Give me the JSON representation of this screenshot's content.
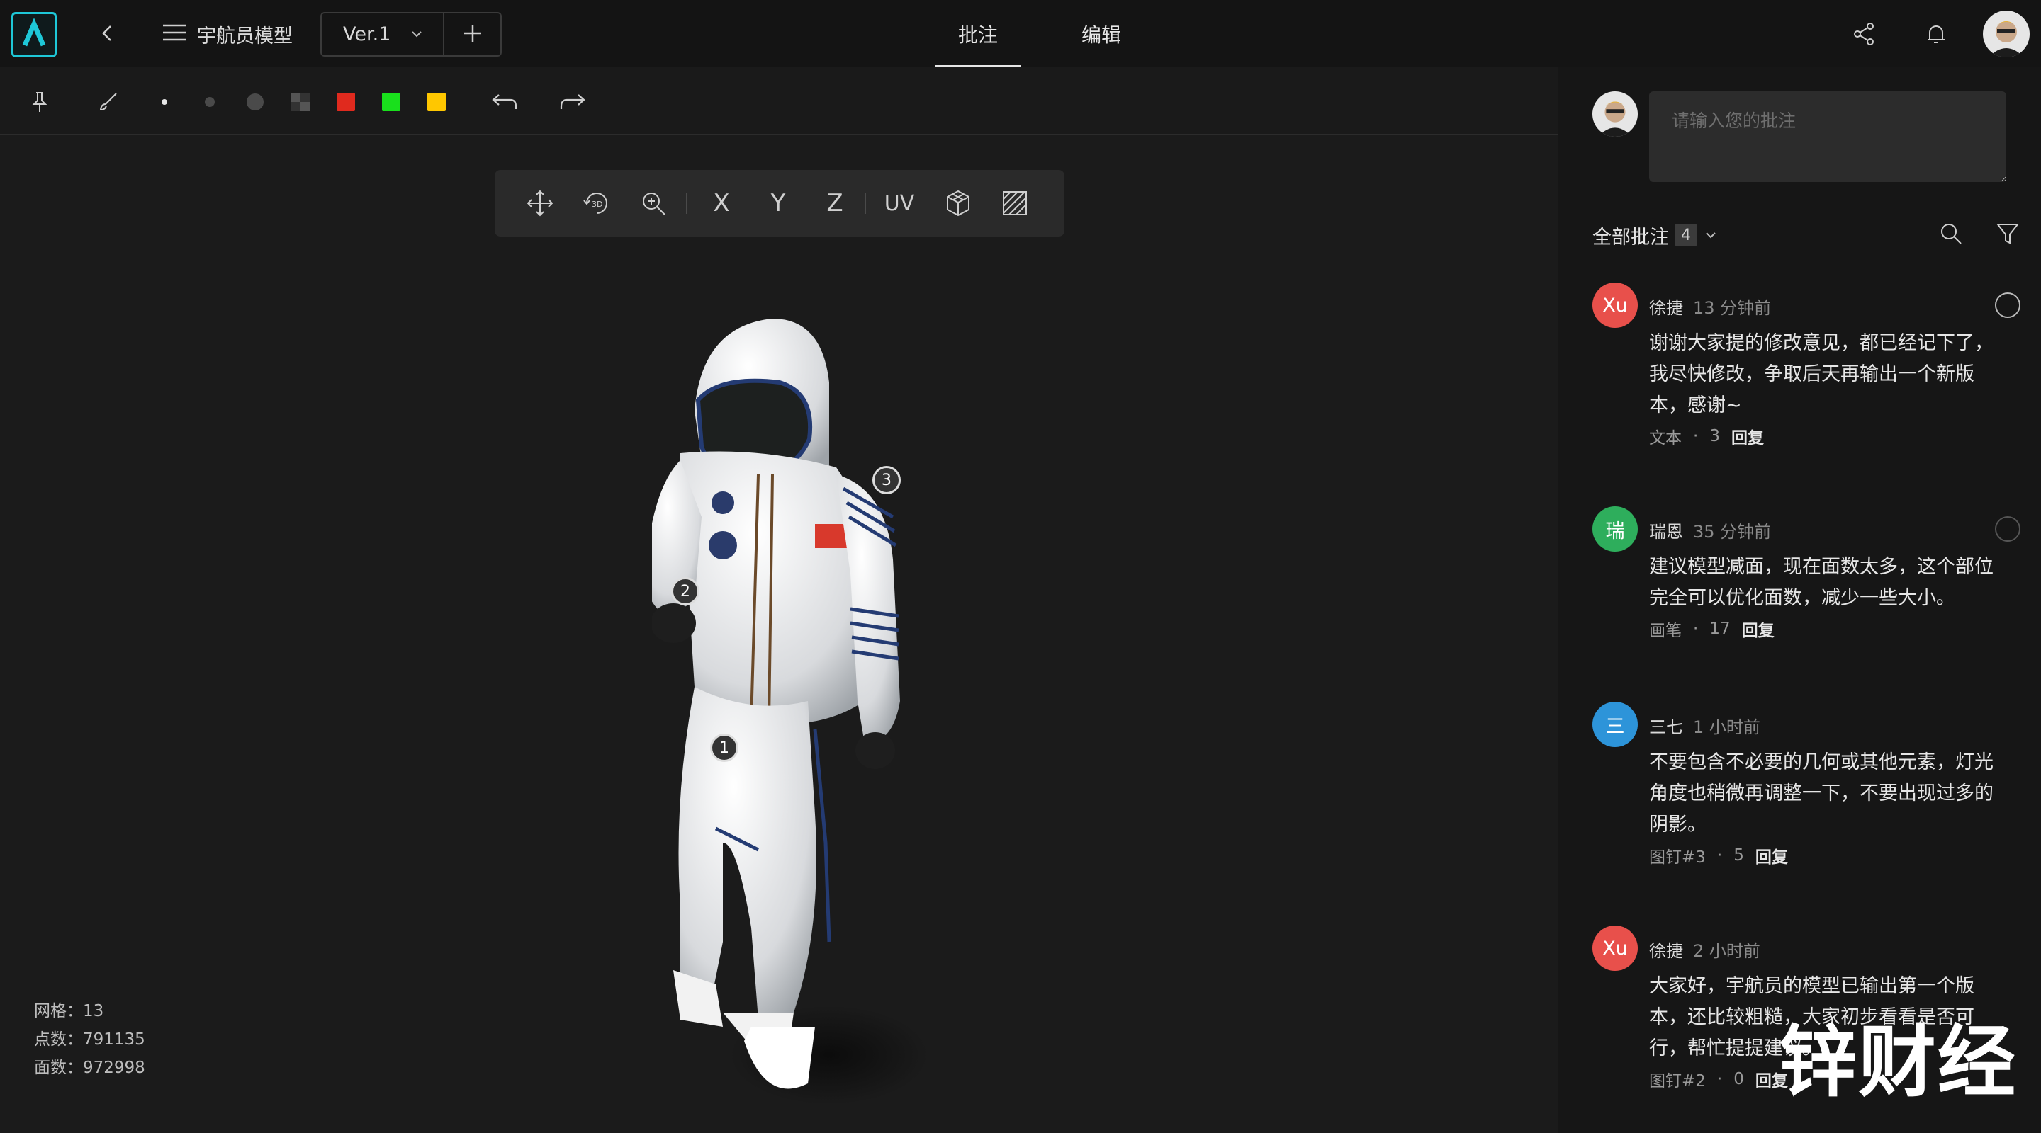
{
  "header": {
    "project_title": "宇航员模型",
    "version": "Ver.1",
    "tabs": [
      {
        "label": "批注",
        "active": true
      },
      {
        "label": "编辑",
        "active": false
      }
    ],
    "icons": [
      "logo-icon",
      "back-icon",
      "menu-icon",
      "chevron-down-icon",
      "plus-icon",
      "share-icon",
      "bell-icon",
      "user-avatar"
    ],
    "accent_color": "#1ec8d8"
  },
  "toolbar": {
    "tools": [
      "pin-icon",
      "brush-icon",
      "dot-small",
      "dot-medium",
      "dot-large",
      "checker-swatch"
    ],
    "colors": [
      "#e02a1e",
      "#19e01c",
      "#ffc700"
    ],
    "undo_icon": "undo-icon",
    "redo_icon": "redo-icon"
  },
  "viewbar": {
    "items": [
      "move-icon",
      "rotate-3d-icon",
      "zoom-icon",
      "X",
      "Y",
      "Z",
      "UV",
      "cube-icon",
      "texture-icon"
    ]
  },
  "viewport": {
    "pins": [
      "1",
      "2",
      "3"
    ],
    "stats": {
      "mesh_label": "网格：",
      "mesh_value": "13",
      "vertex_label": "点数：",
      "vertex_value": "791135",
      "face_label": "面数：",
      "face_value": "972998"
    },
    "watermark": "锌财经"
  },
  "panel": {
    "input_placeholder": "请输入您的批注",
    "filter_title": "全部批注",
    "filter_count": "4",
    "comments": [
      {
        "avatar_text": "Xu",
        "avatar_color": "#e8504b",
        "name": "徐捷",
        "time": "13 分钟前",
        "body": "谢谢大家提的修改意见，都已经记下了，我尽快修改，争取后天再输出一个新版本，感谢~",
        "type": "文本",
        "dot": "·",
        "count": "3",
        "reply": "回复"
      },
      {
        "avatar_text": "瑞",
        "avatar_color": "#2eae5c",
        "name": "瑞恩",
        "time": "35 分钟前",
        "body": "建议模型减面，现在面数太多，这个部位完全可以优化面数，减少一些大小。",
        "type": "画笔",
        "dot": "·",
        "count": "17",
        "reply": "回复"
      },
      {
        "avatar_text": "三",
        "avatar_color": "#2d94d9",
        "name": "三七",
        "time": "1 小时前",
        "body": "不要包含不必要的几何或其他元素，灯光角度也稍微再调整一下，不要出现过多的阴影。",
        "type": "图钉#3",
        "dot": "·",
        "count": "5",
        "reply": "回复"
      },
      {
        "avatar_text": "Xu",
        "avatar_color": "#e8504b",
        "name": "徐捷",
        "time": "2 小时前",
        "body": "大家好，宇航员的模型已输出第一个版本，还比较粗糙，大家初步看看是否可行，帮忙提提建议。",
        "type": "图钉#2",
        "dot": "·",
        "count": "0",
        "reply": "回复"
      }
    ]
  }
}
